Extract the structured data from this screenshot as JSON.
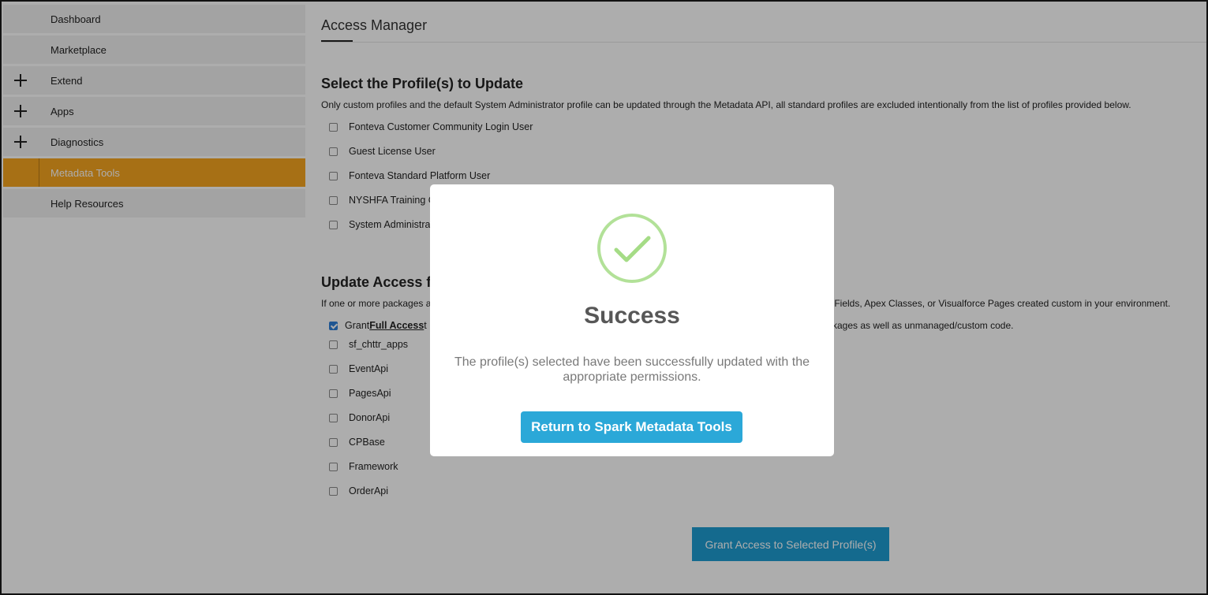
{
  "sidebar": {
    "items": [
      {
        "label": "Dashboard",
        "expandable": false,
        "active": false
      },
      {
        "label": "Marketplace",
        "expandable": false,
        "active": false
      },
      {
        "label": "Extend",
        "expandable": true,
        "active": false
      },
      {
        "label": "Apps",
        "expandable": true,
        "active": false
      },
      {
        "label": "Diagnostics",
        "expandable": true,
        "active": false
      },
      {
        "label": "Metadata Tools",
        "expandable": false,
        "active": true
      },
      {
        "label": "Help Resources",
        "expandable": false,
        "active": false
      }
    ]
  },
  "main": {
    "title": "Access Manager",
    "profiles_section": {
      "heading": "Select the Profile(s) to Update",
      "description": "Only custom profiles and the default System Administrator profile can be updated through the Metadata API, all standard profiles are excluded intentionally from the list of profiles provided below.",
      "profiles": [
        {
          "label": "Fonteva Customer Community Login User",
          "checked": false
        },
        {
          "label": "Guest License User",
          "checked": false
        },
        {
          "label": "Fonteva Standard Platform User",
          "checked": false
        },
        {
          "label": "NYSHFA Training C",
          "checked": false
        },
        {
          "label": "System Administra",
          "checked": false
        }
      ]
    },
    "access_section": {
      "heading": "Update Access f",
      "description_start": "If one or more packages a",
      "description_end": "m Fields, Apex Classes, or Visualforce Pages created custom in your environment.",
      "grant_prefix": "Grant ",
      "grant_bold": "Full Access",
      "grant_suffix_start": " t",
      "grant_suffix_end": "kages as well as unmanaged/custom code.",
      "grant_checked": true,
      "packages": [
        {
          "label": "sf_chttr_apps",
          "checked": false
        },
        {
          "label": "EventApi",
          "checked": false
        },
        {
          "label": "PagesApi",
          "checked": false
        },
        {
          "label": "DonorApi",
          "checked": false
        },
        {
          "label": "CPBase",
          "checked": false
        },
        {
          "label": "Framework",
          "checked": false
        },
        {
          "label": "OrderApi",
          "checked": false
        }
      ]
    },
    "grant_button_label": "Grant Access to Selected Profile(s)"
  },
  "modal": {
    "icon": "checkmark-circle-icon",
    "title": "Success",
    "message": "The profile(s) selected have been successfully updated with the appropriate permissions.",
    "button_label": "Return to Spark Metadata Tools",
    "colors": {
      "success_green": "#a5dc86",
      "button_blue": "#2ba8d8"
    }
  },
  "colors": {
    "active_sidebar": "#f7a520",
    "primary_button": "#1e9dd2"
  }
}
